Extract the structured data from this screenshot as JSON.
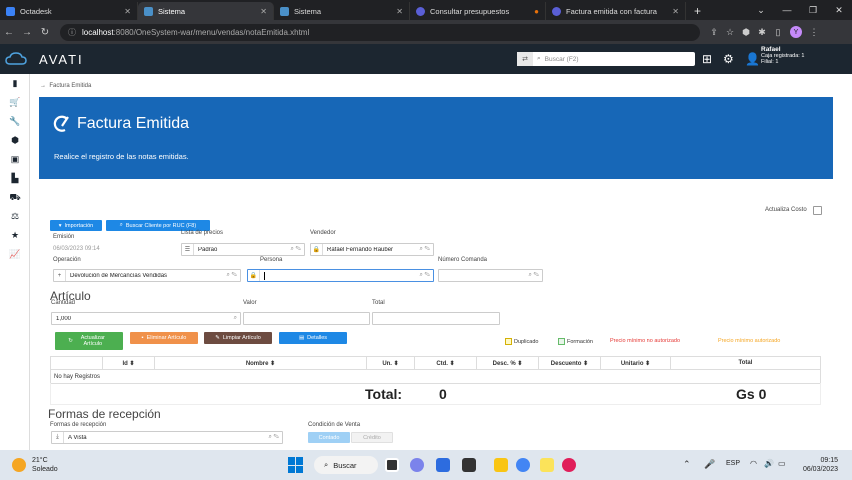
{
  "browser": {
    "tabs": [
      {
        "label": "Octadesk",
        "color": "#3b82f6"
      },
      {
        "label": "Sistema",
        "color": "#4a90c8"
      },
      {
        "label": "Sistema",
        "color": "#4a90c8"
      },
      {
        "label": "Consultar presupuestos",
        "color": "#5a5fd6"
      },
      {
        "label": "Factura emitida con factura",
        "color": "#5a5fd6"
      }
    ],
    "url_host": "localhost",
    "url_path": ":8080/OneSystem-war/menu/vendas/notaEmitida.xhtml",
    "profile_initial": "Y"
  },
  "header": {
    "brand": "AVATI",
    "search_placeholder": "Buscar (F2)",
    "user_name": "Rafael",
    "user_line2": "Caja registrada: 1",
    "user_line3": "Filial: 1"
  },
  "breadcrumb": "Factura Emitida",
  "banner": {
    "title": "Factura Emitida",
    "subtitle": "Realice el registro de las notas emitidas."
  },
  "actualiza_costo": "Actualiza Costo",
  "buttons": {
    "importacion": "Importación",
    "buscar_ruc": "Buscar Cliente por RUC (F8)",
    "actualizar": "Actualizar Artículo",
    "eliminar": "Eliminar Artículo",
    "limpiar": "Limpiar Artículo",
    "detalles": "Detalles",
    "contado": "Contado",
    "credito": "Crédito"
  },
  "form": {
    "emision_label": "Emisión",
    "emision_value": "06/03/2023 09:14",
    "lista_label": "Lista de precios",
    "lista_value": "Padrão",
    "vendedor_label": "Vendedor",
    "vendedor_value": "Rafael Fernando Rauber",
    "operacion_label": "Operación",
    "operacion_value": "Devolución de Mercancías Vendidas",
    "persona_label": "Persona",
    "persona_value": "",
    "comanda_label": "Número Comanda",
    "comanda_value": ""
  },
  "articulo": {
    "title": "Artículo",
    "cantidad_label": "Cantidad",
    "cantidad_value": "1,000",
    "valor_label": "Valor",
    "total_label": "Total"
  },
  "legend": {
    "duplicado": "Duplicado",
    "formacion": "Formación",
    "precio_no_aut": "Precio mínimo no autorizado",
    "precio_aut": "Precio mínimo autorizado"
  },
  "table": {
    "columns": [
      "",
      "Id",
      "Nombre",
      "Un.",
      "Ctd.",
      "Desc. %",
      "Descuento",
      "Unitario",
      "Total"
    ],
    "empty": "No hay Registros"
  },
  "totals": {
    "label": "Total:",
    "qty": "0",
    "amount": "Gs 0"
  },
  "recepcion": {
    "title": "Formas de recepción",
    "formas_label": "Formas de recepción",
    "formas_value": "A Vista",
    "condicion_label": "Condición de Venta"
  },
  "taskbar": {
    "temp": "21°C",
    "weather": "Soleado",
    "search": "Buscar",
    "lang": "ESP",
    "time": "09:15",
    "date": "06/03/2023"
  }
}
